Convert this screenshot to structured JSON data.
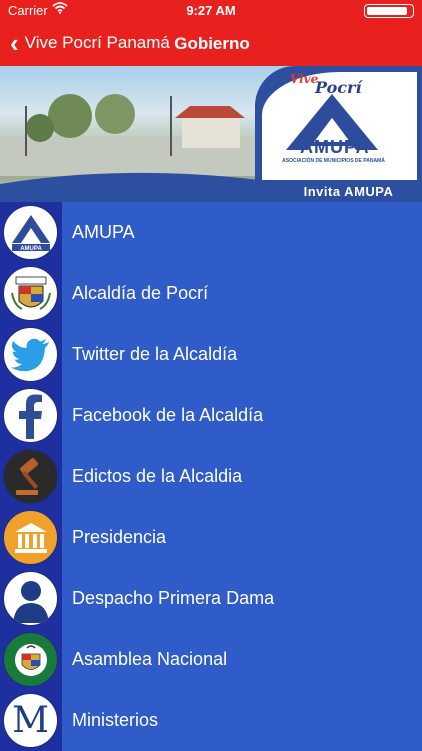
{
  "status_bar": {
    "carrier": "Carrier",
    "time": "9:27 AM"
  },
  "nav": {
    "back_label": "Vive Pocrí Panamá",
    "title": "Gobierno"
  },
  "banner": {
    "vive": "Vive",
    "pocri": "Pocrí",
    "logo_text": "AMUPA",
    "association": "ASOCIACIÓN DE MUNICIPIOS DE PANAMÁ",
    "tagline": "Invita  AMUPA"
  },
  "colors": {
    "accent_red": "#e8211f",
    "list_blue": "#2f5cc8",
    "icon_column": "#1e2fa0"
  },
  "items": [
    {
      "label": "AMUPA",
      "icon": "amupa-logo-icon"
    },
    {
      "label": "Alcaldía de Pocrí",
      "icon": "coat-of-arms-icon"
    },
    {
      "label": "Twitter de la Alcaldía",
      "icon": "twitter-bird-icon"
    },
    {
      "label": "Facebook de la  Alcaldía",
      "icon": "facebook-f-icon"
    },
    {
      "label": "Edictos de la Alcaldia",
      "icon": "gavel-icon"
    },
    {
      "label": "Presidencia",
      "icon": "government-building-icon"
    },
    {
      "label": "Despacho Primera Dama",
      "icon": "person-silhouette-icon"
    },
    {
      "label": "Asamblea Nacional",
      "icon": "national-assembly-seal-icon"
    },
    {
      "label": "Ministerios",
      "icon": "ministerios-m-icon"
    }
  ]
}
